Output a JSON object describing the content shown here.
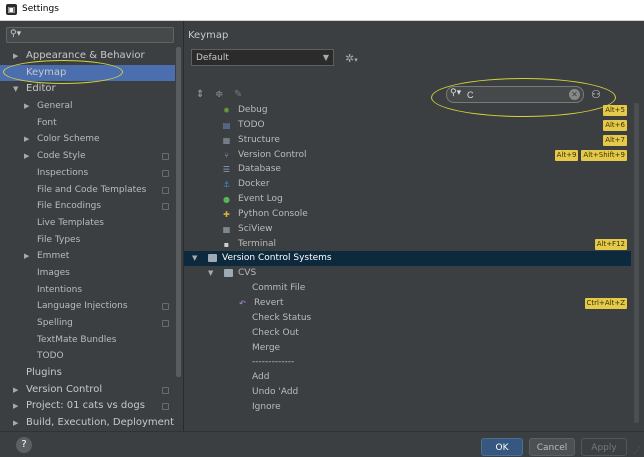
{
  "window": {
    "title": "Settings"
  },
  "sidebar": {
    "search_placeholder": "",
    "items": [
      {
        "label": "Appearance & Behavior",
        "level": 0,
        "arrow": "right"
      },
      {
        "label": "Keymap",
        "level": 0,
        "selected": true
      },
      {
        "label": "Editor",
        "level": 0,
        "arrow": "down"
      },
      {
        "label": "General",
        "level": 1,
        "arrow": "right"
      },
      {
        "label": "Font",
        "level": 1
      },
      {
        "label": "Color Scheme",
        "level": 1,
        "arrow": "right"
      },
      {
        "label": "Code Style",
        "level": 1,
        "arrow": "right",
        "cfg": true
      },
      {
        "label": "Inspections",
        "level": 1,
        "cfg": true
      },
      {
        "label": "File and Code Templates",
        "level": 1,
        "cfg": true
      },
      {
        "label": "File Encodings",
        "level": 1,
        "cfg": true
      },
      {
        "label": "Live Templates",
        "level": 1
      },
      {
        "label": "File Types",
        "level": 1
      },
      {
        "label": "Emmet",
        "level": 1,
        "arrow": "right"
      },
      {
        "label": "Images",
        "level": 1
      },
      {
        "label": "Intentions",
        "level": 1
      },
      {
        "label": "Language Injections",
        "level": 1,
        "cfg": true
      },
      {
        "label": "Spelling",
        "level": 1,
        "cfg": true
      },
      {
        "label": "TextMate Bundles",
        "level": 1
      },
      {
        "label": "TODO",
        "level": 1
      },
      {
        "label": "Plugins",
        "level": 0
      },
      {
        "label": "Version Control",
        "level": 0,
        "arrow": "right",
        "cfg": true
      },
      {
        "label": "Project: 01 cats vs dogs",
        "level": 0,
        "arrow": "right",
        "cfg": true
      },
      {
        "label": "Build, Execution, Deployment",
        "level": 0,
        "arrow": "right"
      }
    ]
  },
  "main": {
    "title": "Keymap",
    "scheme": "Default",
    "search_value": "C",
    "rows": [
      {
        "label": "Debug",
        "indent": 1,
        "icon": "bug-icon",
        "icon_char": "✹",
        "icon_color": "#6a9a3a",
        "shortcuts": [
          "Alt+5"
        ]
      },
      {
        "label": "TODO",
        "indent": 1,
        "icon": "todo-icon",
        "icon_char": "▤",
        "icon_color": "#6a8fc4",
        "shortcuts": [
          "Alt+6"
        ]
      },
      {
        "label": "Structure",
        "indent": 1,
        "icon": "structure-icon",
        "icon_char": "▦",
        "icon_color": "#8a9aa8",
        "shortcuts": [
          "Alt+7"
        ]
      },
      {
        "label": "Version Control",
        "indent": 1,
        "icon": "version-control-icon",
        "icon_char": "⑂",
        "icon_color": "#7ba0d4",
        "shortcuts": [
          "Alt+9",
          "Alt+Shift+9"
        ]
      },
      {
        "label": "Database",
        "indent": 1,
        "icon": "database-icon",
        "icon_char": "☰",
        "icon_color": "#8fa7c4",
        "shortcuts": []
      },
      {
        "label": "Docker",
        "indent": 1,
        "icon": "docker-icon",
        "icon_char": "⚓",
        "icon_color": "#3d8fd4",
        "shortcuts": []
      },
      {
        "label": "Event Log",
        "indent": 1,
        "icon": "event-log-icon",
        "icon_char": "●",
        "icon_color": "#57b45a",
        "shortcuts": []
      },
      {
        "label": "Python Console",
        "indent": 1,
        "icon": "python-console-icon",
        "icon_char": "✚",
        "icon_color": "#d4b23d",
        "shortcuts": []
      },
      {
        "label": "SciView",
        "indent": 1,
        "icon": "sciview-icon",
        "icon_char": "▦",
        "icon_color": "#9aa7b0",
        "shortcuts": []
      },
      {
        "label": "Terminal",
        "indent": 1,
        "icon": "terminal-icon",
        "icon_char": "▪",
        "icon_color": "#d0d0d0",
        "shortcuts": [
          "Alt+F12"
        ]
      },
      {
        "label": "Version Control Systems",
        "indent": 0,
        "arrow": "down",
        "folder": true,
        "selected": true,
        "shortcuts": []
      },
      {
        "label": "CVS",
        "indent": 1,
        "arrow": "down",
        "folder": true,
        "shortcuts": []
      },
      {
        "label": "Commit File",
        "indent": 2,
        "shortcuts": []
      },
      {
        "label": "Revert",
        "indent": 2,
        "icon": "revert-icon",
        "icon_char": "↶",
        "icon_color": "#b38fe0",
        "shortcuts": [
          "Ctrl+Alt+Z"
        ]
      },
      {
        "label": "Check Status",
        "indent": 2,
        "shortcuts": []
      },
      {
        "label": "Check Out",
        "indent": 2,
        "shortcuts": []
      },
      {
        "label": "Merge",
        "indent": 2,
        "shortcuts": []
      },
      {
        "label": "-------------",
        "indent": 2,
        "shortcuts": []
      },
      {
        "label": "Add",
        "indent": 2,
        "shortcuts": []
      },
      {
        "label": "Undo 'Add",
        "indent": 2,
        "shortcuts": []
      },
      {
        "label": "Ignore",
        "indent": 2,
        "shortcuts": []
      }
    ]
  },
  "buttons": {
    "ok": "OK",
    "cancel": "Cancel",
    "apply": "Apply",
    "help": "?"
  },
  "colors": {
    "background": "#3c3f41",
    "selection": "#4b6eaf",
    "shortcut_badge": "#e4c94b",
    "annotation": "#d6d23a",
    "ok_button": "#365880"
  }
}
